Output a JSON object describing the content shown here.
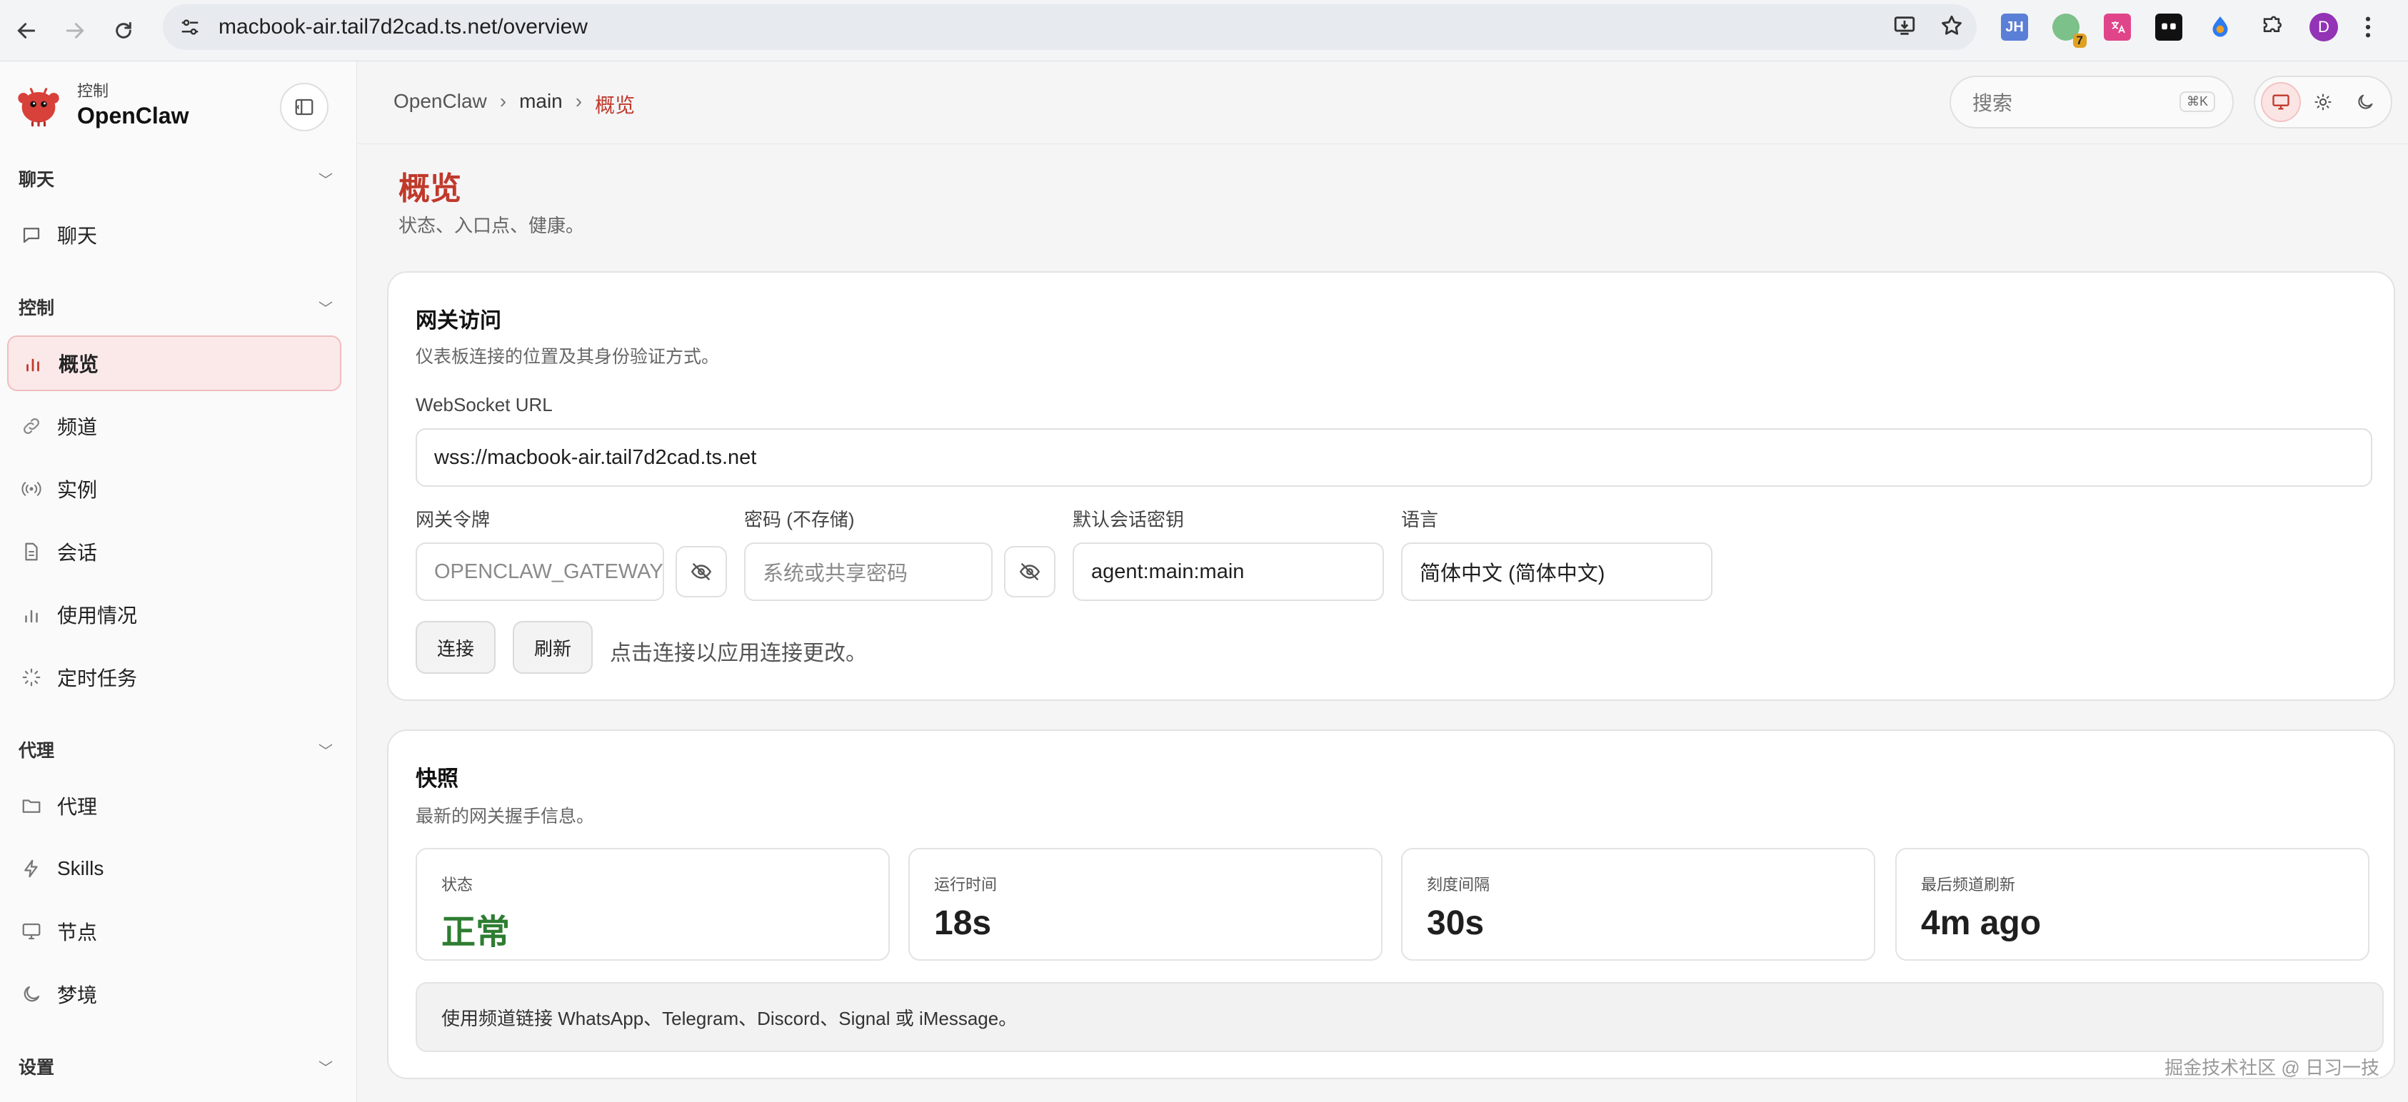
{
  "browser": {
    "url": "macbook-air.tail7d2cad.ts.net/overview",
    "ext_jh": "JH",
    "ext_badge": "7",
    "profile_initial": "D"
  },
  "sidebar": {
    "brand_sub": "控制",
    "brand_name": "OpenClaw",
    "sections": {
      "chat": "聊天",
      "control": "控制",
      "agent": "代理",
      "settings": "设置"
    },
    "items": {
      "chat": "聊天",
      "overview": "概览",
      "channels": "频道",
      "instances": "实例",
      "sessions": "会话",
      "usage": "使用情况",
      "cron": "定时任务",
      "agents": "代理",
      "skills": "Skills",
      "nodes": "节点",
      "dreams": "梦境"
    }
  },
  "header": {
    "crumb_root": "OpenClaw",
    "crumb_mid": "main",
    "crumb_current": "概览",
    "search_placeholder": "搜索",
    "search_kbd": "⌘K"
  },
  "page": {
    "title": "概览",
    "subtitle": "状态、入口点、健康。"
  },
  "gateway": {
    "title": "网关访问",
    "desc": "仪表板连接的位置及其身份验证方式。",
    "ws_label": "WebSocket URL",
    "ws_value": "wss://macbook-air.tail7d2cad.ts.net",
    "token_label": "网关令牌",
    "token_placeholder": "OPENCLAW_GATEWAY_TOKEN",
    "password_label": "密码 (不存储)",
    "password_placeholder": "系统或共享密码",
    "session_label": "默认会话密钥",
    "session_value": "agent:main:main",
    "lang_label": "语言",
    "lang_value": "简体中文 (简体中文)",
    "connect_label": "连接",
    "refresh_label": "刷新",
    "hint": "点击连接以应用连接更改。"
  },
  "snapshot": {
    "title": "快照",
    "desc": "最新的网关握手信息。",
    "stats": [
      {
        "label": "状态",
        "value": "正常"
      },
      {
        "label": "运行时间",
        "value": "18s"
      },
      {
        "label": "刻度间隔",
        "value": "30s"
      },
      {
        "label": "最后频道刷新",
        "value": "4m ago"
      }
    ],
    "callout": "使用频道链接 WhatsApp、Telegram、Discord、Signal 或 iMessage。"
  },
  "watermark": "掘金技术社区 @ 日习一技",
  "colors": {
    "accent": "#c0392b",
    "ok": "#2e7d32"
  }
}
